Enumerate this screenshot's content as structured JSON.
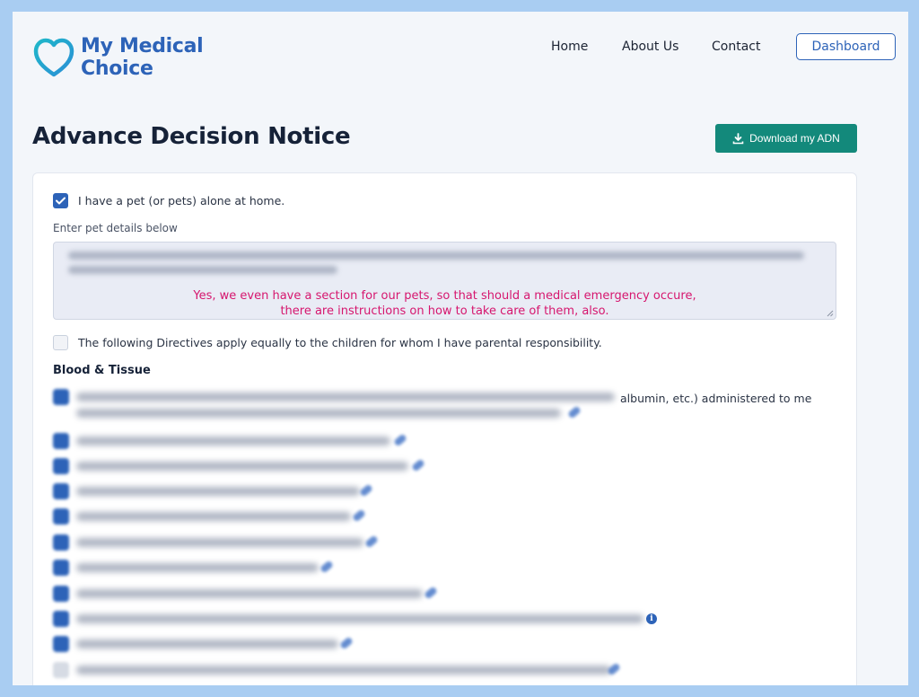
{
  "brand": {
    "name_line1": "My Medical",
    "name_line2": "Choice"
  },
  "nav": {
    "home": "Home",
    "about": "About Us",
    "contact": "Contact",
    "dashboard": "Dashboard"
  },
  "page": {
    "title": "Advance Decision Notice",
    "download_label": "Download my ADN"
  },
  "pets": {
    "checkbox_label": "I have a pet (or pets) alone at home.",
    "checked": true,
    "details_label": "Enter pet details below",
    "annotation_line1": "Yes, we even have a section for our pets, so that should a medical emergency occure,",
    "annotation_line2": "there are instructions on how to take care of them, also."
  },
  "children": {
    "checkbox_label": "The following Directives apply equally to the children for whom I have parental responsibility.",
    "checked": false
  },
  "blood_tissue": {
    "title": "Blood & Tissue",
    "first_item_visible_fragment": "albumin, etc.) administered to me",
    "items_checked": [
      true,
      true,
      true,
      true,
      true,
      true,
      true,
      true,
      true,
      true,
      false
    ]
  },
  "colors": {
    "brand_blue": "#2d63b8",
    "teal": "#13897b",
    "annotation_pink": "#d6166e",
    "frame_blue": "#a9cdf2"
  },
  "icons": [
    "heart-logo-icon",
    "download-icon",
    "check-icon",
    "info-icon",
    "resize-handle-icon"
  ]
}
